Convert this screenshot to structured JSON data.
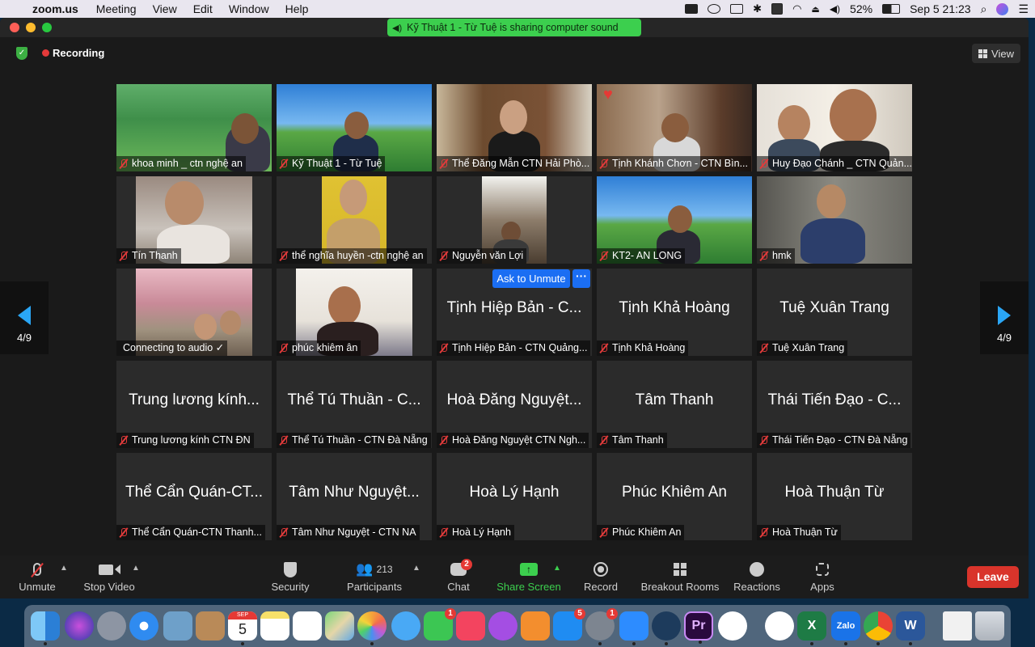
{
  "menubar": {
    "app": "zoom.us",
    "items": [
      "Meeting",
      "View",
      "Edit",
      "Window",
      "Help"
    ],
    "battery": "52%",
    "datetime": "Sep 5  21:23"
  },
  "share_banner": "Kỹ Thuật 1  - Từ Tuệ is sharing computer sound",
  "recording_label": "Recording",
  "view_label": "View",
  "page_indicator": "4/9",
  "ask_to_unmute": "Ask to Unmute",
  "more_dots": "···",
  "tiles": [
    {
      "label": "khoa minh _ ctn nghệ an",
      "muted": true
    },
    {
      "label": "Kỹ Thuật 1  - Từ Tuệ",
      "muted": true
    },
    {
      "label": "Thể Đăng Mẫn CTN Hải Phò...",
      "muted": true
    },
    {
      "label": "Tịnh Khánh Chơn - CTN Bìn...",
      "muted": true
    },
    {
      "label": "Huy Đạo Chánh _ CTN Quản...",
      "muted": true
    },
    {
      "label": "Tín Thanh",
      "muted": true
    },
    {
      "label": "thể nghĩa huyền -ctn nghệ an",
      "muted": true
    },
    {
      "label": "Nguyễn văn Lợi",
      "muted": true
    },
    {
      "label": "KT2- AN LONG",
      "muted": true
    },
    {
      "label": "hmk",
      "muted": true
    },
    {
      "label": "Connecting to audio ✓",
      "muted": false
    },
    {
      "label": "phúc khiêm ân",
      "muted": true
    },
    {
      "big": "Tịnh Hiệp Bản - C...",
      "label": "Tịnh Hiệp Bản - CTN Quảng...",
      "muted": true
    },
    {
      "big": "Tịnh Khả Hoàng",
      "label": "Tịnh Khả Hoàng",
      "muted": true
    },
    {
      "big": "Tuệ Xuân Trang",
      "label": "Tuệ Xuân Trang",
      "muted": true
    },
    {
      "big": "Trung lương kính...",
      "label": "Trung lương kính CTN ĐN",
      "muted": true
    },
    {
      "big": "Thể Tú Thuần - C...",
      "label": "Thể Tú Thuần - CTN Đà Nẵng",
      "muted": true
    },
    {
      "big": "Hoà Đăng Nguyệt...",
      "label": "Hoà Đăng Nguyệt CTN Ngh...",
      "muted": true
    },
    {
      "big": "Tâm Thanh",
      "label": "Tâm Thanh",
      "muted": true
    },
    {
      "big": "Thái Tiến Đạo - C...",
      "label": "Thái Tiến Đạo - CTN Đà Nẵng",
      "muted": true
    },
    {
      "big": "Thể Cẩn Quán-CT...",
      "label": "Thể Cẩn Quán-CTN Thanh...",
      "muted": true
    },
    {
      "big": "Tâm Như Nguyệt...",
      "label": "Tâm Như Nguyệt - CTN NA",
      "muted": true
    },
    {
      "big": "Hoà Lý Hạnh",
      "label": "Hoà Lý Hạnh",
      "muted": true
    },
    {
      "big": "Phúc Khiêm An",
      "label": "Phúc Khiêm An",
      "muted": true
    },
    {
      "big": "Hoà Thuận Từ",
      "label": "Hoà Thuận Từ",
      "muted": true
    }
  ],
  "toolbar": {
    "unmute": "Unmute",
    "stop_video": "Stop Video",
    "security": "Security",
    "participants": "Participants",
    "participants_count": "213",
    "chat": "Chat",
    "chat_badge": "2",
    "share_screen": "Share Screen",
    "record": "Record",
    "breakout_rooms": "Breakout Rooms",
    "reactions": "Reactions",
    "apps": "Apps",
    "leave": "Leave"
  },
  "colors": {
    "share_green": "#3ccf4e",
    "leave_red": "#d9342b",
    "ask_blue": "#1b6ef3",
    "mute_red": "#e23b3b"
  },
  "dock": {
    "calendar_month": "SEP",
    "calendar_day": "5",
    "badge_messages": "1",
    "badge_appstore": "5",
    "badge_settings": "1",
    "premiere": "Pr",
    "excel": "X",
    "zalo": "Zalo",
    "word": "W",
    "apps": [
      "finder-icon",
      "siri-icon",
      "launchpad-icon",
      "safari-icon",
      "preview-icon",
      "contacts-icon",
      "calendar-icon",
      "notes-icon",
      "reminders-icon",
      "maps-icon",
      "photos-icon",
      "messages-icon",
      "facetime-icon",
      "music-icon",
      "podcasts-icon",
      "books-icon",
      "appstore-icon",
      "settings-icon",
      "zoom-icon",
      "quicktime-icon",
      "premiere-icon",
      "evernote-icon",
      "evernote2-icon",
      "excel-icon",
      "zalo-icon",
      "chrome-icon",
      "word-icon",
      "document-icon",
      "trash-icon"
    ]
  }
}
